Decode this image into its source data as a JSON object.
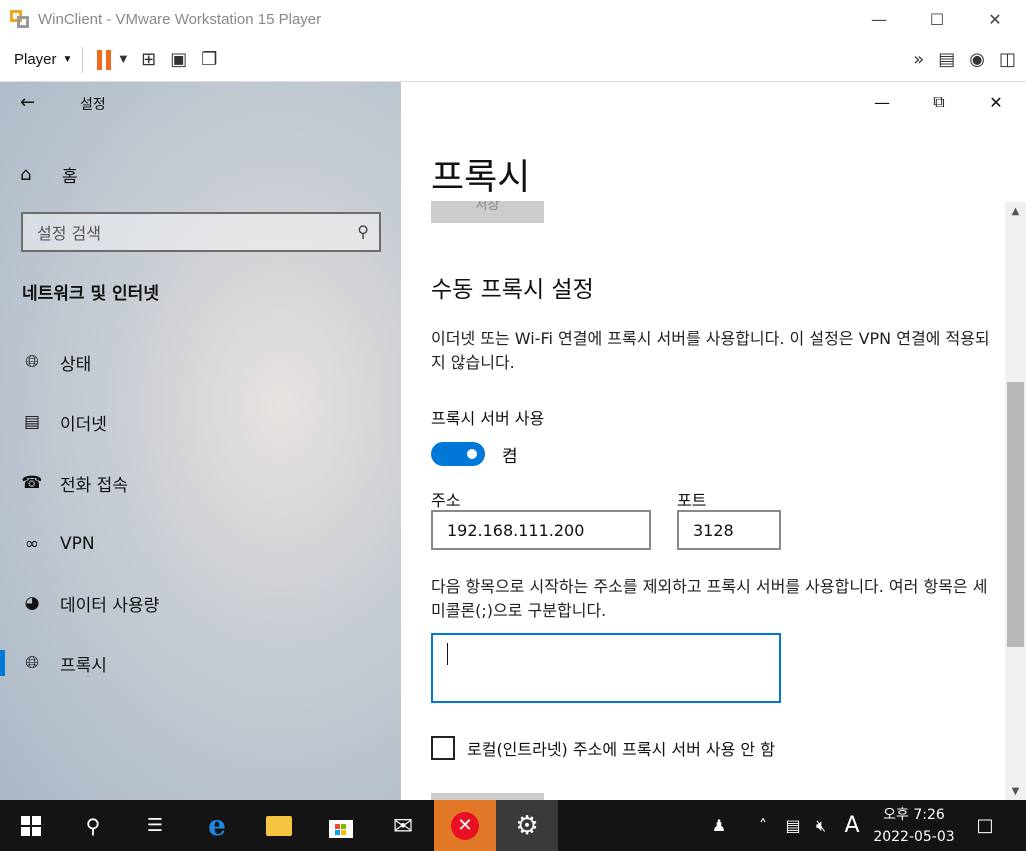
{
  "vmware": {
    "title": "WinClient - VMware Workstation 15 Player",
    "player_menu": "Player"
  },
  "settings": {
    "header_label": "설정",
    "home": "홈",
    "search_placeholder": "설정 검색",
    "section_title": "네트워크 및 인터넷",
    "nav_items": [
      {
        "label": "상태",
        "icon": "globe-icon",
        "active": false
      },
      {
        "label": "이더넷",
        "icon": "ethernet-icon",
        "active": false
      },
      {
        "label": "전화 접속",
        "icon": "dialup-icon",
        "active": false
      },
      {
        "label": "VPN",
        "icon": "vpn-icon",
        "active": false
      },
      {
        "label": "데이터 사용량",
        "icon": "pie-chart-icon",
        "active": false
      },
      {
        "label": "프록시",
        "icon": "globe-icon",
        "active": true
      }
    ]
  },
  "proxy": {
    "page_title": "프록시",
    "save_label_top": "저장",
    "manual_title": "수동 프록시 설정",
    "description": "이더넷 또는 Wi-Fi 연결에 프록시 서버를 사용합니다. 이 설정은 VPN 연결에 적용되지 않습니다.",
    "use_proxy_label": "프록시 서버 사용",
    "toggle_state": "켬",
    "address_label": "주소",
    "address_value": "192.168.111.200",
    "port_label": "포트",
    "port_value": "3128",
    "exclusion_desc": "다음 항목으로 시작하는 주소를 제외하고 프록시 서버를 사용합니다. 여러 항목은 세미콜론(;)으로 구분합니다.",
    "exclusion_value": "",
    "local_checkbox_label": "로컬(인트라넷) 주소에 프록시 서버 사용 안 함",
    "local_checked": false
  },
  "taskbar": {
    "time": "오후 7:26",
    "date": "2022-05-03",
    "ime": "A"
  },
  "colors": {
    "accent": "#0078d7",
    "vm_pause": "#ef6c1e",
    "taskbar": "#141414"
  }
}
